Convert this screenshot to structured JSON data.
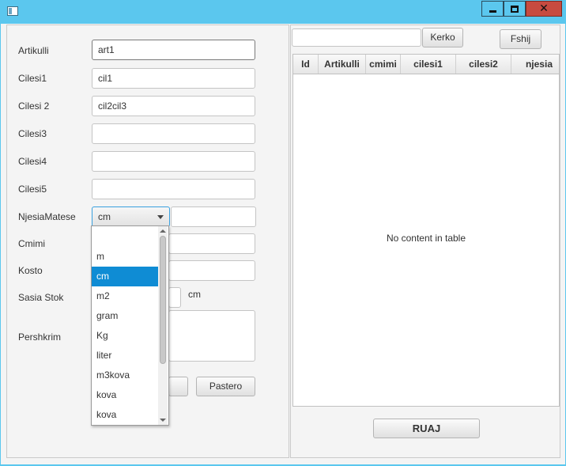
{
  "form": {
    "labels": {
      "artikulli": "Artikulli",
      "cilesi1": "Cilesi1",
      "cilesi2": "Cilesi 2",
      "cilesi3": "Cilesi3",
      "cilesi4": "Cilesi4",
      "cilesi5": "Cilesi5",
      "njesia": "NjesiaMatese",
      "cmimi": "Cmimi",
      "kosto": "Kosto",
      "sasia": "Sasia Stok",
      "pershkrim": "Pershkrim"
    },
    "values": {
      "artikulli": "art1",
      "cilesi1": "cil1",
      "cilesi2": "cil2cil3",
      "cilesi3": "",
      "cilesi4": "",
      "cilesi5": "",
      "njesia_selected": "cm",
      "njesia_extra": "",
      "unit_suffix": "cm"
    },
    "pastero_label": "Pastero"
  },
  "dropdown": {
    "options": [
      "",
      "m",
      "cm",
      "m2",
      "gram",
      "Kg",
      "liter",
      "m3kova",
      "kova",
      "kova"
    ],
    "selected_index": 2
  },
  "search": {
    "value": "",
    "kerko_label": "Kerko",
    "fshij_label": "Fshij"
  },
  "table": {
    "columns": [
      "Id",
      "Artikulli",
      "cmimi",
      "cilesi1",
      "cilesi2",
      "njesia"
    ],
    "empty_text": "No content in table"
  },
  "ruaj_label": "RUAJ",
  "colors": {
    "title_bar": "#5bc7ee",
    "close_button": "#c74b40",
    "selection": "#0f8cd4",
    "focus_border": "#39a0de"
  }
}
